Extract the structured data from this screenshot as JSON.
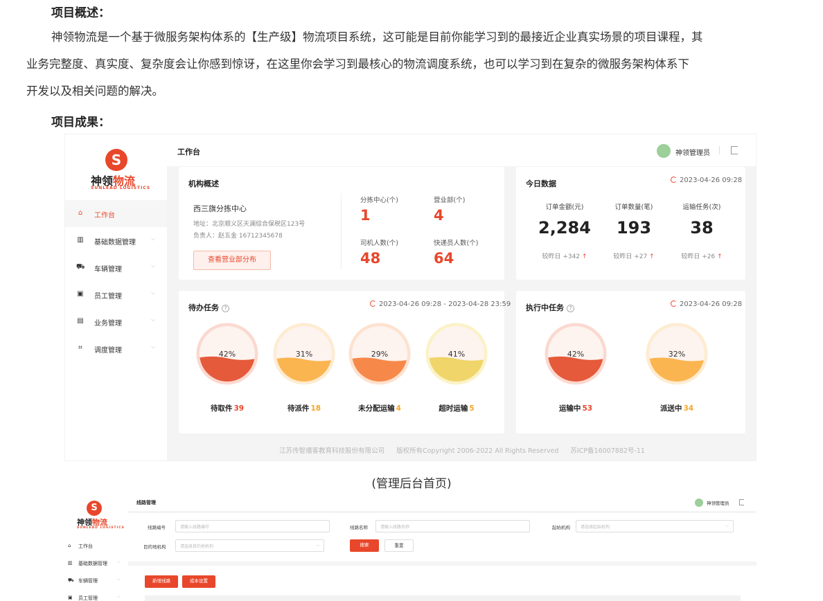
{
  "doc": {
    "heading_overview": "项目概述：",
    "overview_line1": "神领物流是一个基于微服务架构体系的【生产级】物流项目系统，这可能是目前你能学习到的最接近企业真实场景的项目课程，其",
    "overview_line2": "业务完整度、真实度、复杂度会让你感到惊讶，在这里你会学习到最核心的物流调度系统，也可以学习到在复杂的微服务架构体系下",
    "overview_line3": "开发以及相关问题的解决。",
    "heading_results": "项目成果：",
    "caption_1": "(管理后台首页)"
  },
  "brand": {
    "logo_glyph": "S",
    "name_part1": "神领",
    "name_part2": "物流",
    "subtitle": "SUNLEAD LOGISTICS",
    "accent_color": "#e8472b"
  },
  "nav": [
    {
      "label": "工作台",
      "icon": "home-icon",
      "glyph": "⌂",
      "active": true
    },
    {
      "label": "基础数据管理",
      "icon": "bar-chart-icon",
      "glyph": "▥",
      "active": false
    },
    {
      "label": "车辆管理",
      "icon": "truck-icon",
      "glyph": "⛟",
      "active": false
    },
    {
      "label": "员工管理",
      "icon": "id-card-icon",
      "glyph": "▣",
      "active": false
    },
    {
      "label": "业务管理",
      "icon": "clipboard-icon",
      "glyph": "▤",
      "active": false
    },
    {
      "label": "调度管理",
      "icon": "dispatch-icon",
      "glyph": "⌗",
      "active": false
    }
  ],
  "dashboard": {
    "title": "工作台",
    "admin": "神领管理员",
    "org": {
      "title": "机构概述",
      "name": "西三旗分拣中心",
      "address": "地址：北京顺义区天澜综合保税区123号",
      "manager": "负责人：赵五金 16712345678",
      "button": "查看营业部分布",
      "stats": [
        {
          "label": "分拣中心(个)",
          "value": "1"
        },
        {
          "label": "营业部(个)",
          "value": "4"
        },
        {
          "label": "司机人数(个)",
          "value": "48"
        },
        {
          "label": "快递员人数(个)",
          "value": "64"
        }
      ]
    },
    "today": {
      "title": "今日数据",
      "time": "2023-04-26 09:28",
      "items": [
        {
          "label": "订单金额(元)",
          "value": "2,284",
          "compare": "较昨日 +342"
        },
        {
          "label": "订单数量(笔)",
          "value": "193",
          "compare": "较昨日 +27"
        },
        {
          "label": "运输任务(次)",
          "value": "38",
          "compare": "较昨日 +26"
        }
      ]
    },
    "pending": {
      "title": "待办任务",
      "time": "2023-04-26 09:28 - 2023-04-28 23:59",
      "items": [
        {
          "label": "待取件",
          "count": "39",
          "percent": "42%",
          "fraction": 0.42,
          "color": "#e55a3a",
          "light": "#fbd9d0",
          "count_color": "#e8472b"
        },
        {
          "label": "待派件",
          "count": "18",
          "percent": "31%",
          "fraction": 0.31,
          "color": "#fbb550",
          "light": "#feecd2",
          "count_color": "#f5a623"
        },
        {
          "label": "未分配运输",
          "count": "4",
          "percent": "29%",
          "fraction": 0.29,
          "color": "#f6894a",
          "light": "#fde2cf",
          "count_color": "#f5a623"
        },
        {
          "label": "超时运输",
          "count": "5",
          "percent": "41%",
          "fraction": 0.41,
          "color": "#f0d56a",
          "light": "#fbf2c8",
          "count_color": "#f5a623"
        }
      ]
    },
    "executing": {
      "title": "执行中任务",
      "time": "2023-04-26 09:28",
      "items": [
        {
          "label": "运输中",
          "count": "53",
          "percent": "42%",
          "fraction": 0.42,
          "color": "#e55a3a",
          "light": "#fbd9d0",
          "count_color": "#e8472b"
        },
        {
          "label": "派送中",
          "count": "34",
          "percent": "32%",
          "fraction": 0.32,
          "color": "#fbb550",
          "light": "#feecd2",
          "count_color": "#f5a623"
        }
      ]
    },
    "footer": {
      "company": "江苏传智播客教育科技股份有限公司",
      "copyright": "版权所有Copyright 2006-2022 All Rights Reserved",
      "icp": "苏ICP备16007882号-11"
    }
  },
  "route_page": {
    "title": "线路管理",
    "admin": "神领管理员",
    "nav": [
      {
        "label": "工作台",
        "glyph": "⌂"
      },
      {
        "label": "基础数据管理",
        "glyph": "▥"
      },
      {
        "label": "车辆管理",
        "glyph": "⛟"
      },
      {
        "label": "员工管理",
        "glyph": "▣"
      }
    ],
    "filters": {
      "route_no_label": "线路编号",
      "route_no_placeholder": "请输入线路编号",
      "route_name_label": "线路名称",
      "route_name_placeholder": "请输入线路名称",
      "start_org_label": "起始机构",
      "start_org_placeholder": "请选择起始机构",
      "dest_org_label": "目的地机构",
      "dest_org_placeholder": "请选择目的地机构",
      "search": "搜索",
      "reset": "重置"
    },
    "actions": {
      "add": "新增线路",
      "cost": "成本设置"
    }
  }
}
